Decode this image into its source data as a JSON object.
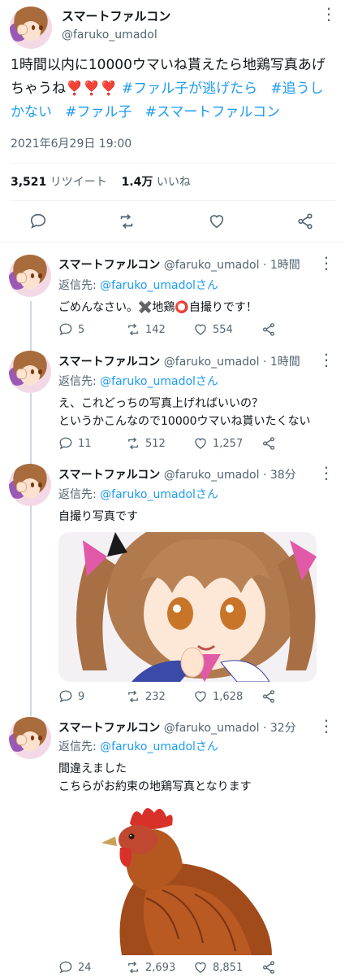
{
  "main": {
    "name": "スマートファルコン",
    "handle": "@faruko_umadol",
    "text": "1時間以内に10000ウマいね貰えたら地鶏写真あげちゃうね❣️❣️❣️",
    "hashtags": [
      "#ファル子が逃げたら",
      "#追うしかない",
      "#ファル子",
      "#スマートファルコン"
    ],
    "timestamp": "2021年6月29日 19:00",
    "retweets_count": "3,521",
    "retweets_label": "リツイート",
    "likes_count": "1.4万",
    "likes_label": "いいね"
  },
  "replies": [
    {
      "name": "スマートファルコン",
      "handle": "@faruko_umadol",
      "time": "· 1時間",
      "reply_prefix": "返信先: ",
      "reply_to": "@faruko_umadolさん",
      "text_lines": [
        "ごめんなさい。✖️地鶏⭕️自撮りです！"
      ],
      "replies": "5",
      "retweets": "142",
      "likes": "554"
    },
    {
      "name": "スマートファルコン",
      "handle": "@faruko_umadol",
      "time": "· 1時間",
      "reply_prefix": "返信先: ",
      "reply_to": "@faruko_umadolさん",
      "text_lines": [
        "え、これどっちの写真上げればいいの？",
        "というかこんなので10000ウマいね貰いたくない"
      ],
      "replies": "11",
      "retweets": "512",
      "likes": "1,257"
    },
    {
      "name": "スマートファルコン",
      "handle": "@faruko_umadol",
      "time": "· 38分",
      "reply_prefix": "返信先: ",
      "reply_to": "@faruko_umadolさん",
      "text_lines": [
        "自撮り写真です"
      ],
      "replies": "9",
      "retweets": "232",
      "likes": "1,628"
    },
    {
      "name": "スマートファルコン",
      "handle": "@faruko_umadol",
      "time": "· 32分",
      "reply_prefix": "返信先: ",
      "reply_to": "@faruko_umadolさん",
      "text_lines": [
        "間違えました",
        "こちらがお約束の地鶏写真となります"
      ],
      "replies": "24",
      "retweets": "2,693",
      "likes": "8,851"
    }
  ],
  "icons": [
    "more-icon",
    "reply-icon",
    "retweet-icon",
    "like-icon",
    "share-icon"
  ],
  "colors": {
    "accent": "#1d9bf0",
    "text": "#0f1419",
    "muted": "#536471",
    "divider": "#eff3f4"
  }
}
